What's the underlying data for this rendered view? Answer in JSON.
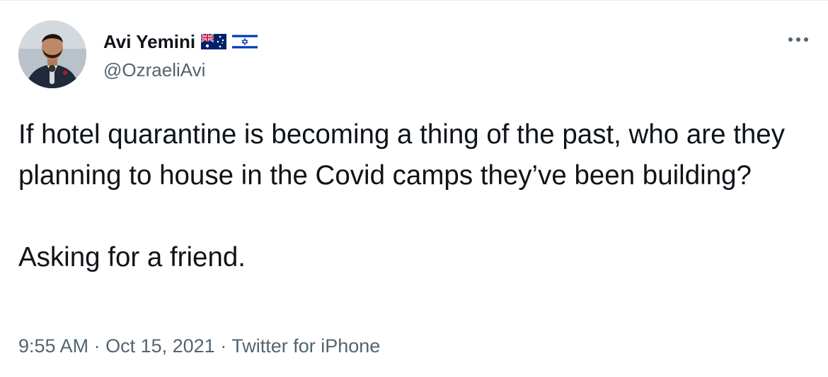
{
  "author": {
    "display_name": "Avi Yemini",
    "handle": "@OzraeliAvi",
    "flags": [
      "flag-australia-icon",
      "flag-israel-icon"
    ]
  },
  "tweet": {
    "lines": [
      "If hotel quarantine is becoming a thing of the past, who are they planning to house in the Covid camps they’ve been building?",
      "Asking for a friend."
    ]
  },
  "meta": {
    "time": "9:55 AM",
    "date": "Oct 15, 2021",
    "source": "Twitter for iPhone",
    "separator": "·"
  },
  "icons": {
    "more": "more-horizontal-icon"
  },
  "colors": {
    "text": "#0f1419",
    "secondary": "#536471",
    "israel_blue": "#0038b8",
    "australia_blue": "#012169",
    "australia_red": "#e4002b"
  }
}
